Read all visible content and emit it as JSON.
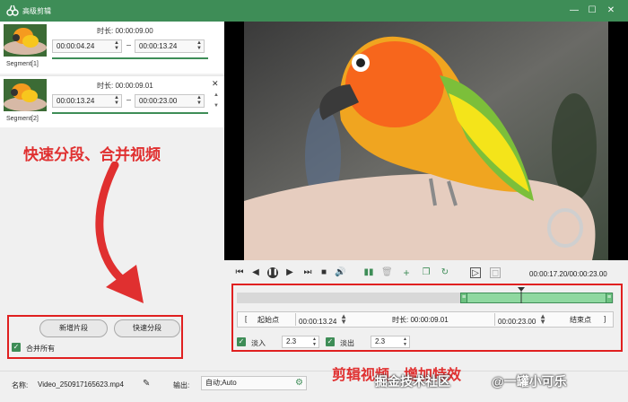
{
  "window": {
    "title": "高级剪辑",
    "min": "—",
    "max": "☐",
    "close": "✕"
  },
  "segments": [
    {
      "label": "Segment[1]",
      "duration": "时长: 00:00:09.00",
      "start": "00:00:04.24",
      "end": "00:00:13.24"
    },
    {
      "label": "Segment[2]",
      "duration": "时长: 00:00:09.01",
      "start": "00:00:13.24",
      "end": "00:00:23.00"
    }
  ],
  "annotations": {
    "left": "快速分段、合并视频",
    "bottom": "剪辑视频、增加特效"
  },
  "buttons": {
    "add_segment": "新增片段",
    "quick_split": "快速分段",
    "merge_all": "合并所有"
  },
  "bottom": {
    "name_label": "名称:",
    "name_value": "Video_250917165623.mp4",
    "output_label": "输出:",
    "output_value": "自动;Auto"
  },
  "playback": {
    "time": "00:00:17.20/00:00:23.00"
  },
  "clip": {
    "start_btn": "起始点",
    "start_value": "00:00:13.24",
    "duration": "时长: 00:00:09.01",
    "end_value": "00:00:23.00",
    "end_btn": "结束点",
    "bracket_open": "[",
    "bracket_close": "]"
  },
  "effects": {
    "fade_in_label": "淡入",
    "fade_in_value": "2.3",
    "fade_out_label": "淡出",
    "fade_out_value": "2.3"
  },
  "watermark": {
    "site": "掘金技术社区",
    "author": "@一罐小可乐"
  },
  "colors": {
    "accent": "#3e8d57",
    "annotation": "#e03030"
  }
}
